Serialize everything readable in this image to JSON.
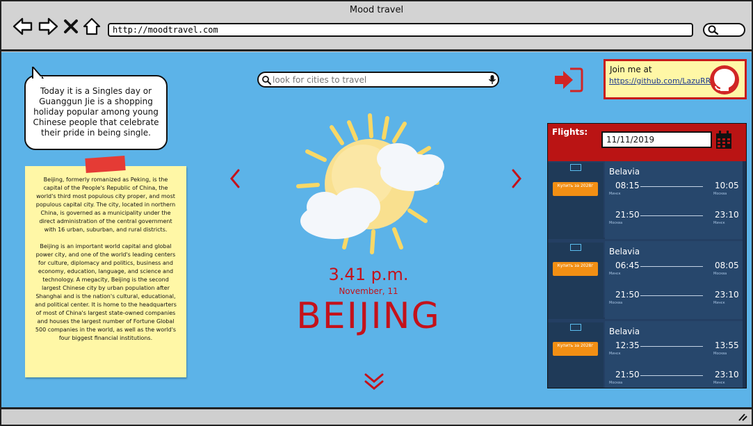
{
  "window": {
    "title": "Mood travel",
    "url": "http://moodtravel.com"
  },
  "bubble": {
    "text": "Today it is a Singles day or Guanggun Jie is a shopping holiday popular among young Chinese people that celebrate their pride in being single."
  },
  "note": {
    "paragraph1": "Beijing, formerly romanized as Peking, is the capital of the People's Republic of China, the world's third most populous city proper, and most populous capital city. The city, located in northern China, is governed as a municipality under the direct administration of the central government with 16 urban, suburban, and rural districts.",
    "paragraph2": "Beijing is an important world capital and global power city, and one of the world's leading centers for culture, diplomacy and politics, business and economy, education, language, and science and technology. A megacity, Beijing is the second largest Chinese city by urban population after Shanghai and is the nation's cultural, educational, and political center. It is home to the headquarters of most of China's largest state-owned companies and houses the largest number of Fortune Global 500 companies in the world, as well as the world's four biggest financial institutions."
  },
  "search": {
    "placeholder": "look for cities to travel"
  },
  "city": {
    "time": "3.41 p.m.",
    "date": "November, 11",
    "name": "BEIJING"
  },
  "join": {
    "label": "Join me at",
    "link": "https://github.com/LazuRR"
  },
  "flights": {
    "label": "Flights:",
    "date": "11/11/2019",
    "cards": [
      {
        "airline": "Belavia",
        "buy": "Купить за 2028г",
        "seg1": {
          "dep": "08:15",
          "arr": "10:05",
          "dep_city": "Минск",
          "arr_city": "Москва"
        },
        "seg2": {
          "dep": "21:50",
          "arr": "23:10",
          "dep_city": "Москва",
          "arr_city": "Минск"
        }
      },
      {
        "airline": "Belavia",
        "buy": "Купить за 2028г",
        "seg1": {
          "dep": "06:45",
          "arr": "08:05",
          "dep_city": "Минск",
          "arr_city": "Москва"
        },
        "seg2": {
          "dep": "21:50",
          "arr": "23:10",
          "dep_city": "Москва",
          "arr_city": "Минск"
        }
      },
      {
        "airline": "Belavia",
        "buy": "Купить за 2028г",
        "seg1": {
          "dep": "12:35",
          "arr": "13:55",
          "dep_city": "Минск",
          "arr_city": "Москва"
        },
        "seg2": {
          "dep": "21:50",
          "arr": "23:10",
          "dep_city": "Москва",
          "arr_city": "Минск"
        }
      }
    ]
  },
  "colors": {
    "background": "#5cb3e8",
    "accent_red": "#c4121b",
    "note_yellow": "#fff7a6"
  }
}
